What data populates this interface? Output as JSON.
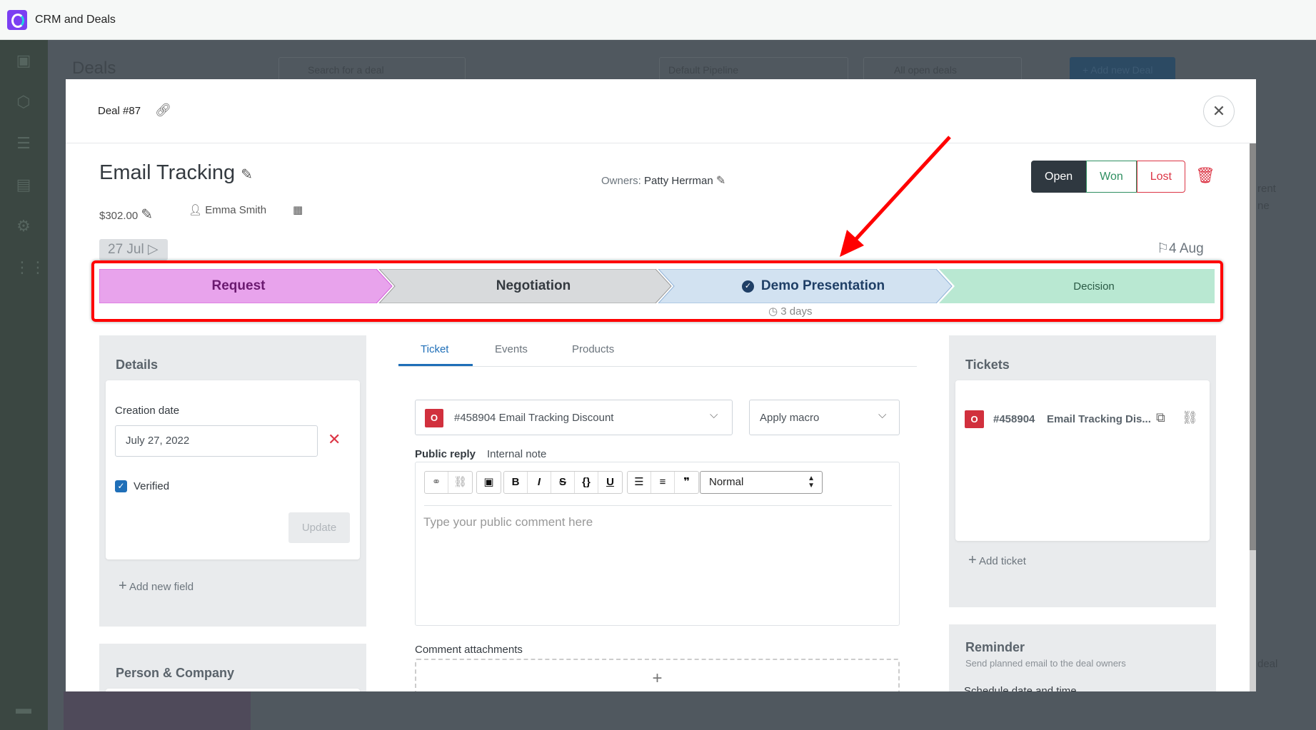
{
  "app": {
    "title": "CRM and Deals"
  },
  "background": {
    "page_title": "Deals",
    "search_placeholder": "Search for a deal",
    "pipeline": "Default Pipeline",
    "filter": "All open deals",
    "add_button": "+ Add new Deal",
    "side_text_1": "rent",
    "side_text_2": "ne",
    "side_text_3": "deal"
  },
  "modal": {
    "deal_number": "Deal #87",
    "title": "Email Tracking",
    "owners_label": "Owners:",
    "owners_value": "Patty Herrman",
    "status_buttons": [
      {
        "label": "Open",
        "active": true
      },
      {
        "label": "Won"
      },
      {
        "label": "Lost"
      }
    ],
    "amount": "$302.00",
    "contact": "Emma Smith",
    "start_date": "27 Jul",
    "end_date": "4 Aug",
    "stages": [
      {
        "label": "Request",
        "color": "#e8a3ec",
        "text_color": "#6b1a70"
      },
      {
        "label": "Negotiation",
        "color": "#d8dadc",
        "text_color": "#343a40"
      },
      {
        "label": "Demo Presentation",
        "color": "#d2e2f1",
        "text_color": "#1f3f66",
        "current": true
      },
      {
        "label": "Decision",
        "color": "#b9e8d2",
        "text_color": "#2a5a45"
      }
    ],
    "stage_duration": "3 days",
    "details": {
      "title": "Details",
      "field_label": "Creation date",
      "field_value": "July 27, 2022",
      "verified_label": "Verified",
      "verified": true,
      "update_label": "Update",
      "add_field_label": "Add new field"
    },
    "person_company": {
      "title": "Person & Company"
    },
    "tabs": [
      {
        "label": "Ticket",
        "active": true
      },
      {
        "label": "Events"
      },
      {
        "label": "Products"
      }
    ],
    "ticket": {
      "badge": "O",
      "selected": "#458904 Email Tracking Discount",
      "macro": "Apply macro",
      "reply_tab": "Public reply",
      "note_tab": "Internal note",
      "format": "Normal",
      "placeholder": "Type your public comment here",
      "attachments_label": "Comment attachments"
    },
    "tickets_panel": {
      "title": "Tickets",
      "badge": "O",
      "ticket_id": "#458904",
      "ticket_title": "Email Tracking Dis...",
      "add_label": "Add ticket"
    },
    "reminder": {
      "title": "Reminder",
      "subtitle": "Send planned email to the deal owners",
      "schedule_label": "Schedule date and time"
    }
  },
  "colors": {
    "accent": "#1f6fb8",
    "danger": "#dc3545",
    "success": "#2f8f61",
    "annotation": "#ff0000"
  }
}
